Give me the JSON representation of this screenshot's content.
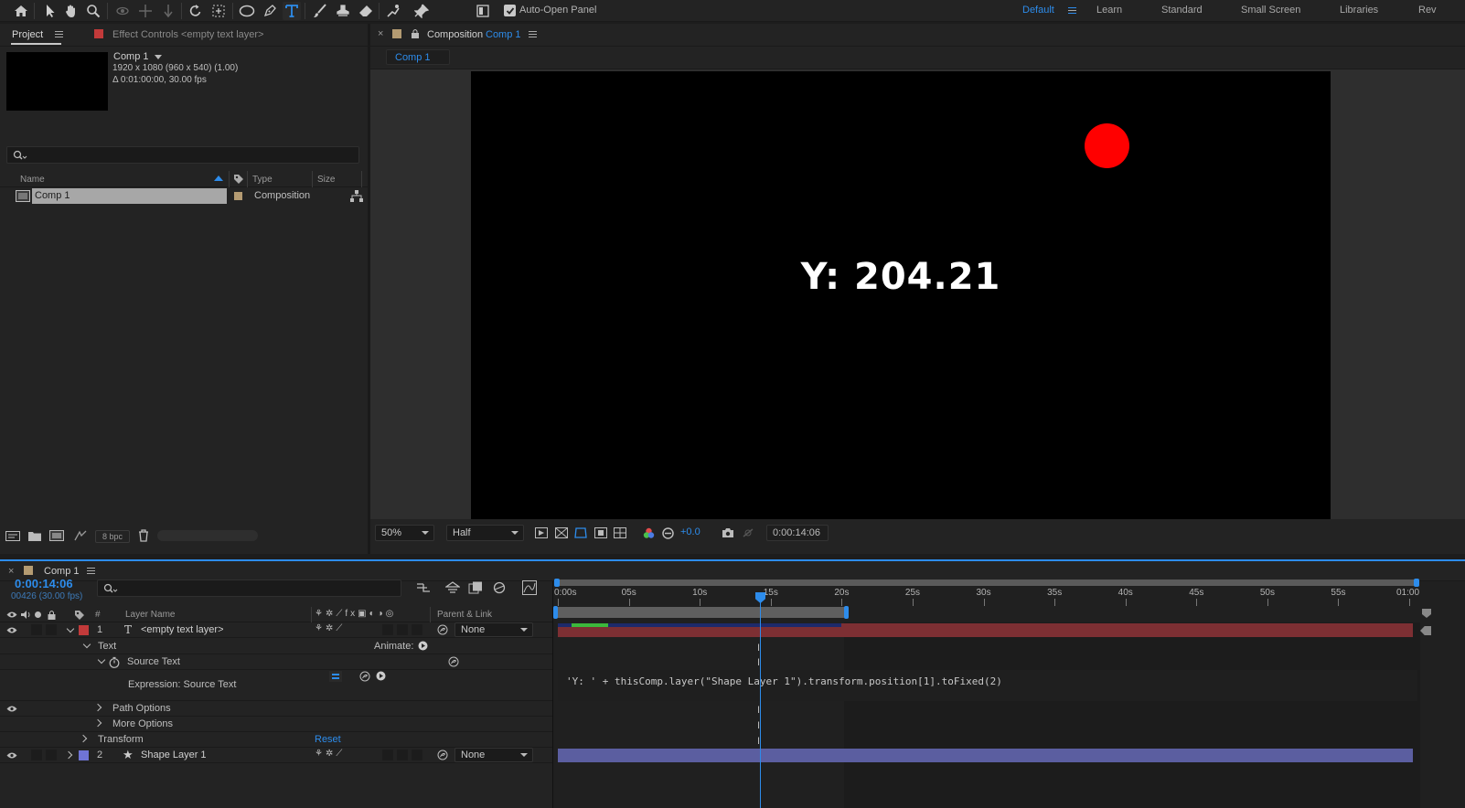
{
  "toolbar": {
    "auto_open_panel_label": "Auto-Open Panel",
    "auto_open_checked": true,
    "workspaces": [
      "Default",
      "Learn",
      "Standard",
      "Small Screen",
      "Libraries",
      "Rev"
    ],
    "active_workspace": "Default"
  },
  "project": {
    "tab_label": "Project",
    "effect_controls_label": "Effect Controls <empty text layer>",
    "comp_name": "Comp 1",
    "comp_resolution": "1920 x 1080  (960 x 540) (1.00)",
    "comp_duration": "Δ 0:01:00:00, 30.00 fps",
    "search_placeholder": "",
    "columns": {
      "name": "Name",
      "type": "Type",
      "size": "Size"
    },
    "items": [
      {
        "name": "Comp 1",
        "type": "Composition",
        "label_color": "#b49b72"
      }
    ],
    "bpc": "8 bpc"
  },
  "composition": {
    "panel_title": "Composition",
    "comp_link": "Comp 1",
    "breadcrumb_tab": "Comp 1",
    "overlay_text": "Y: 204.21",
    "circle_color": "#ff0000",
    "zoom": "50%",
    "resolution": "Half",
    "exposure": "+0.0",
    "timecode": "0:00:14:06"
  },
  "timeline": {
    "tab_label": "Comp 1",
    "current_time": "0:00:14:06",
    "frame_info": "00426 (30.00 fps)",
    "column_heads": {
      "num": "#",
      "layer_name": "Layer Name",
      "parent": "Parent & Link"
    },
    "ruler_labels": [
      "0:00s",
      "05s",
      "10s",
      "15s",
      "20s",
      "25s",
      "30s",
      "35s",
      "40s",
      "45s",
      "50s",
      "55s",
      "01:00"
    ],
    "layers": [
      {
        "num": "1",
        "name": "<empty text layer>",
        "color": "#c23a3a",
        "parent": "None",
        "bar_color": "#7d2f33"
      },
      {
        "num": "2",
        "name": "Shape Layer 1",
        "color": "#6f74d6",
        "parent": "None",
        "bar_color": "#5b5ea0"
      }
    ],
    "props": {
      "text": "Text",
      "animate": "Animate:",
      "source_text": "Source Text",
      "expression_label": "Expression: Source Text",
      "expression_code": "'Y: ' + thisComp.layer(\"Shape Layer 1\").transform.position[1].toFixed(2)",
      "path_options": "Path Options",
      "more_options": "More Options",
      "transform": "Transform",
      "reset": "Reset"
    }
  }
}
